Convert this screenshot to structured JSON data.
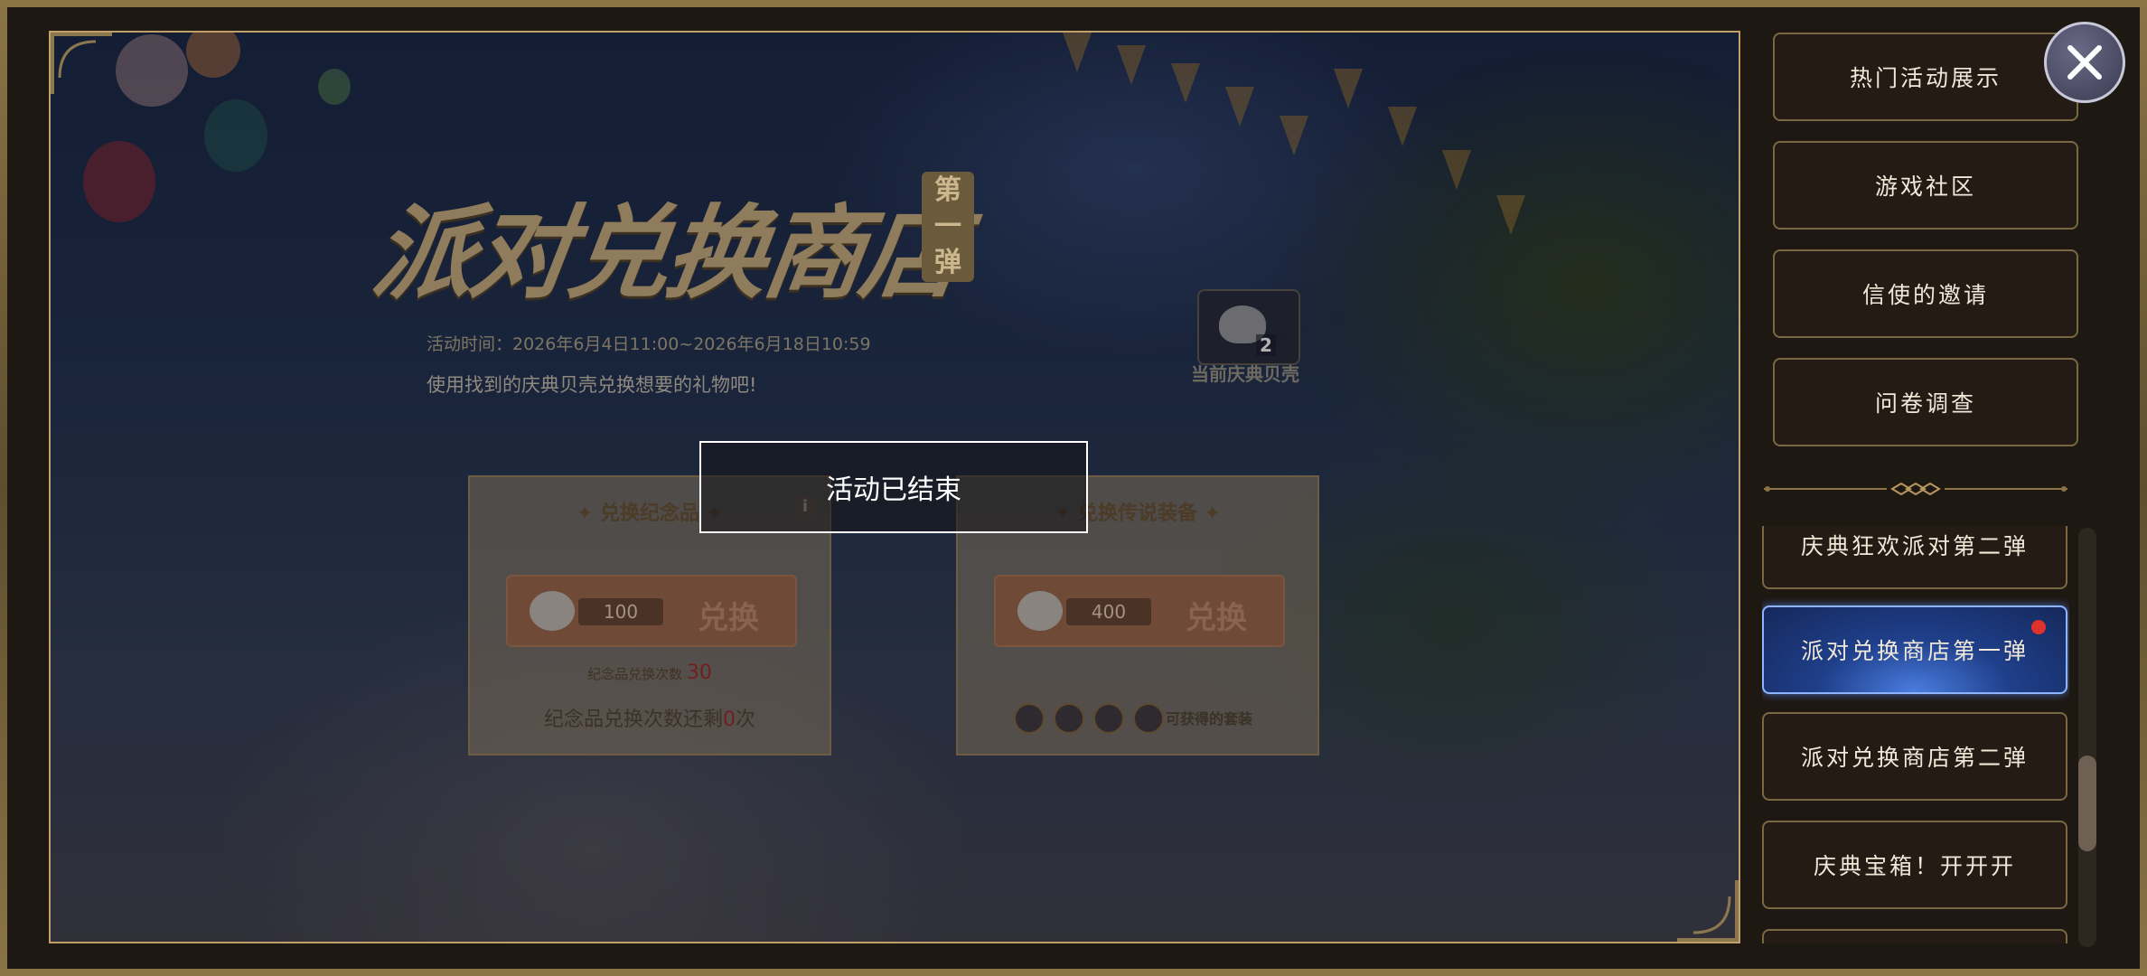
{
  "banner": {
    "title": "派对兑换商店",
    "title_tag": [
      "第",
      "一",
      "弹"
    ],
    "time_text": "活动时间：2026年6月4日11:00~2026年6月18日10:59",
    "description": "使用找到的庆典贝壳兑换想要的礼物吧!",
    "shell_count": "2",
    "shell_label": "当前庆典贝壳"
  },
  "cards": {
    "souvenir": {
      "title": "✦ 兑换纪念品 ✦",
      "info_icon": "i",
      "cost": "100",
      "button_label": "兑换",
      "limit_label": "纪念品兑换次数",
      "limit_value": "30",
      "remain_prefix": "纪念品兑换次数还剩",
      "remain_value": "0",
      "remain_suffix": "次"
    },
    "legend": {
      "title": "✦ 兑换传说装备 ✦",
      "cost": "400",
      "button_label": "兑换",
      "set_label": "可获得的套装"
    }
  },
  "toast": {
    "text": "活动已结束"
  },
  "sidebar": {
    "top_items": [
      "热门活动展示",
      "游戏社区",
      "信使的邀请",
      "问卷调查"
    ],
    "list_items": [
      {
        "label": "庆典狂欢派对第二弹",
        "active": false,
        "badge": false
      },
      {
        "label": "派对兑换商店第一弹",
        "active": true,
        "badge": true
      },
      {
        "label": "派对兑换商店第二弹",
        "active": false,
        "badge": false
      },
      {
        "label": "庆典宝箱！开开开",
        "active": false,
        "badge": false
      }
    ],
    "scroll_position": 0.55
  },
  "icons": {
    "close": "close-icon",
    "shell": "shell-icon",
    "info": "info-icon",
    "divider": "ornament-divider"
  },
  "colors": {
    "accent_gold": "#bfa06a",
    "active_blue": "#2f5fc8",
    "badge_red": "#e0322d"
  }
}
